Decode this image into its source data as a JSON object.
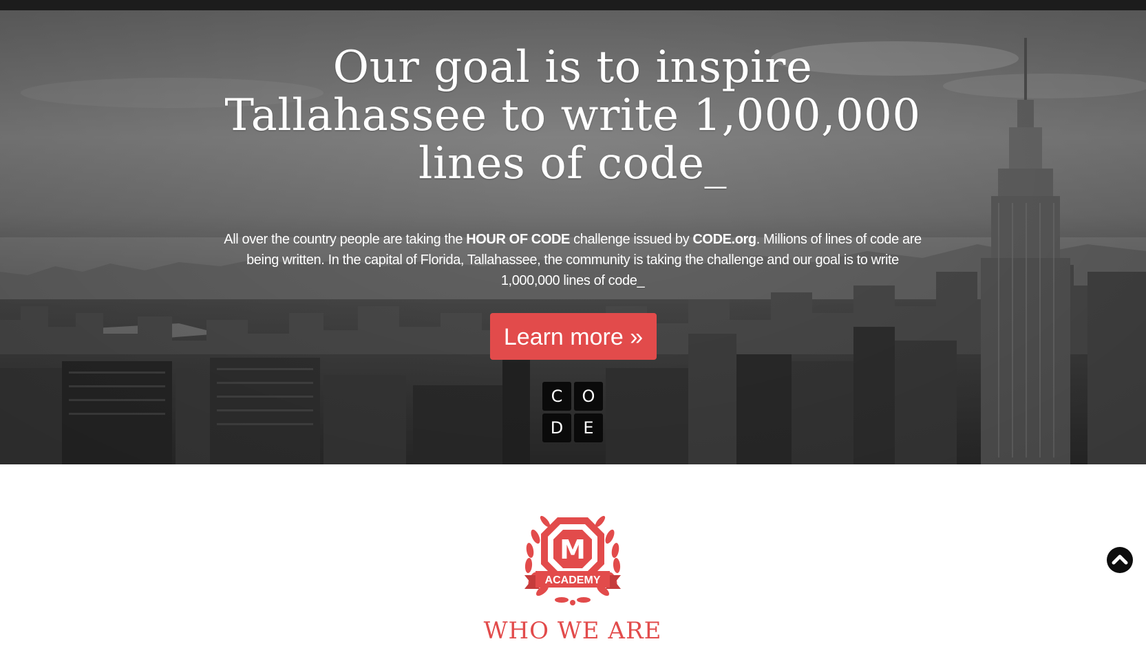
{
  "hero": {
    "headline_line1": "Our goal is to inspire",
    "headline_line2": "Tallahassee to write 1,000,000",
    "headline_line3": "lines of code_",
    "intro_part1": "All over the country people are taking the ",
    "intro_bold1": "HOUR OF CODE",
    "intro_part2": " challenge issued by ",
    "intro_bold2": "CODE.org",
    "intro_part3": ". Millions of lines of code are being written. In the capital of Florida, Tallahassee, the community is taking the challenge and our goal is to write 1,000,000 lines of code_",
    "cta_label": "Learn more »",
    "code_logo": {
      "letters": [
        "C",
        "O",
        "D",
        "E"
      ]
    }
  },
  "about": {
    "badge_letter": "M",
    "badge_ribbon": "ACADEMY",
    "title": "WHO WE ARE"
  },
  "icons": {
    "scroll_top": "chevron-up-icon"
  },
  "colors": {
    "accent": "#e24b4b",
    "topbar": "#1c1c1c",
    "logo_tile": "#0a0a0a"
  }
}
